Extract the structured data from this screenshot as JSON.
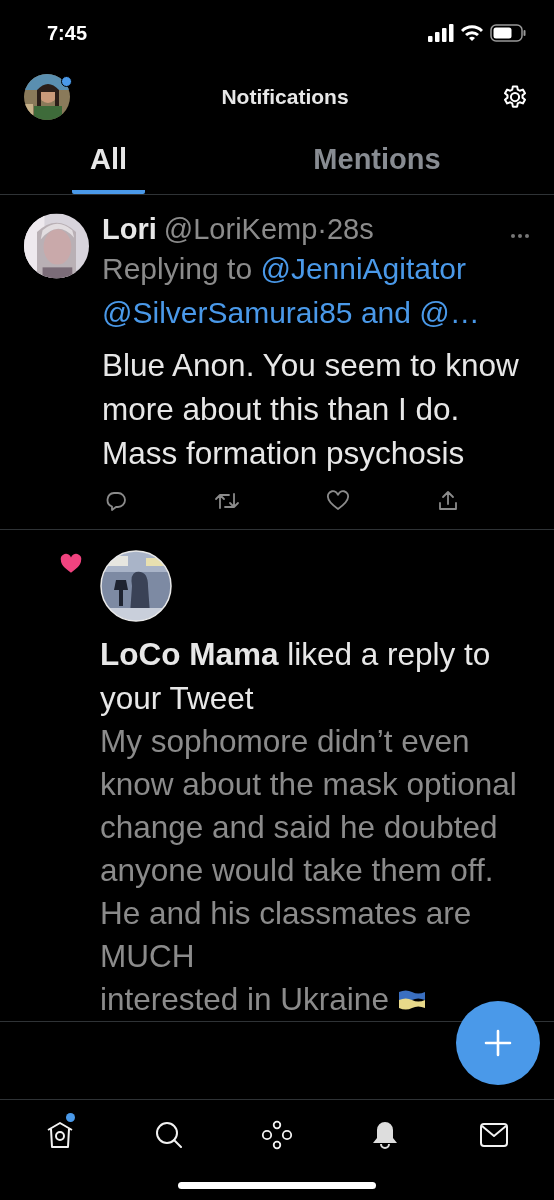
{
  "status_bar": {
    "time": "7:45"
  },
  "header": {
    "title": "Notifications",
    "avatar_badge": true
  },
  "tabs": [
    {
      "label": "All",
      "selected": true
    },
    {
      "label": "Mentions",
      "selected": false
    }
  ],
  "notifications": [
    {
      "kind": "reply",
      "name": "Lori",
      "handle": "@LoriKemp·28s",
      "replying_prefix": "Replying to",
      "replying_to": [
        "@JenniAgitator",
        "@SilverSamurai85",
        "and @…"
      ],
      "text": "Blue Anon. You seem to know more about this than I do. Mass formation psychosis"
    },
    {
      "kind": "like",
      "name": "LoCo Mama",
      "action": "liked a reply to your Tweet",
      "text": "My sophomore didn’t even know about the mask optional change and said he doubted anyone would take them off.  He and his classmates are MUCH",
      "text_end": "interested in Ukraine"
    }
  ],
  "bottom_nav": [
    {
      "badge": true,
      "selected": false
    },
    {
      "badge": false,
      "selected": false
    },
    {
      "badge": false,
      "selected": false
    },
    {
      "badge": false,
      "selected": true
    },
    {
      "badge": false,
      "selected": false
    }
  ]
}
